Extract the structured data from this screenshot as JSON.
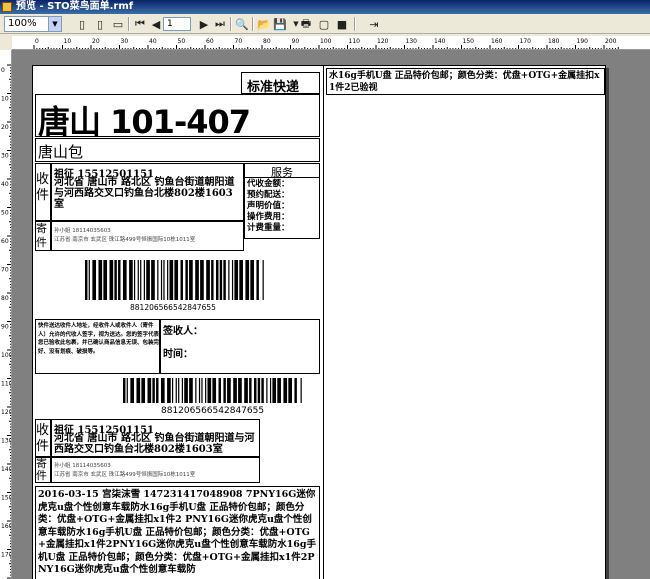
{
  "window": {
    "title": "预览 - STO菜鸟面单.rmf"
  },
  "toolbar": {
    "zoom": "100%",
    "page": "1"
  },
  "ruler": {
    "h_labels": [
      "0",
      "10",
      "20",
      "30",
      "40",
      "50",
      "60",
      "70",
      "80",
      "90",
      "100",
      "110",
      "120",
      "130",
      "140",
      "150",
      "160",
      "170",
      "180",
      "190",
      "200"
    ],
    "v_labels": [
      "0",
      "10",
      "20",
      "30",
      "40",
      "50",
      "60",
      "70",
      "80",
      "90",
      "100",
      "110",
      "120",
      "130",
      "140",
      "150",
      "160",
      "170",
      "180"
    ]
  },
  "label": {
    "brand": "标准快递",
    "route_code": "唐山 101-407",
    "package_point": "唐山包",
    "receiver_side": "收件",
    "receiver": "祖征 15512501151",
    "receiver_address": "河北省 唐山市 路北区 钓鱼台街道朝阳道与河西路交叉口钓鱼台北楼802楼1603室",
    "service_header": "服务",
    "service_items": [
      "代收金额：",
      "预约配送：",
      "声明价值：",
      "操作费用：",
      "计费重量："
    ],
    "sender_side": "寄件",
    "sender": "孙小姐 18114035603",
    "sender_address": "江苏省 南京市 玄武区 珠江路499号恒振国际10栋1011室",
    "barcode_number": "881206566542847655",
    "notice": "快件送达收件人地址，经收件人或收件人（寄件人）允许的代收人签字，视为送达。您的签字代表您已验收此包裹，并已确认商品信息无误、包装完好、没有划痕、破损等。",
    "sign_label": "签收人：",
    "time_label": "时间：",
    "receiver2_address": "河北省 唐山市 路北区 钓鱼台街道朝阳道与河西路交叉口钓鱼台北楼802楼1603室",
    "goods_text": "2016-03-15 宫柒沫雪 147231417048908 7PNY16G迷你虎克u盘个性创意车载防水16g手机U盘 正品特价包邮；颜色分类：优盘+OTG+金属挂扣x1件2 PNY16G迷你虎克u盘个性创意车载防水16g手机U盘 正品特价包邮；颜色分类：优盘+OTG+金属挂扣x1件2PNY16G迷你虎克u盘个性创意车载防水16g手机U盘 正品特价包邮；颜色分类：优盘+OTG+金属挂扣x1件2PNY16G迷你虎克u盘个性创意车载防"
  },
  "page2": {
    "text": "水16g手机U盘 正品特价包邮；颜色分类：优盘+OTG+金属挂扣x1件2已验视"
  }
}
